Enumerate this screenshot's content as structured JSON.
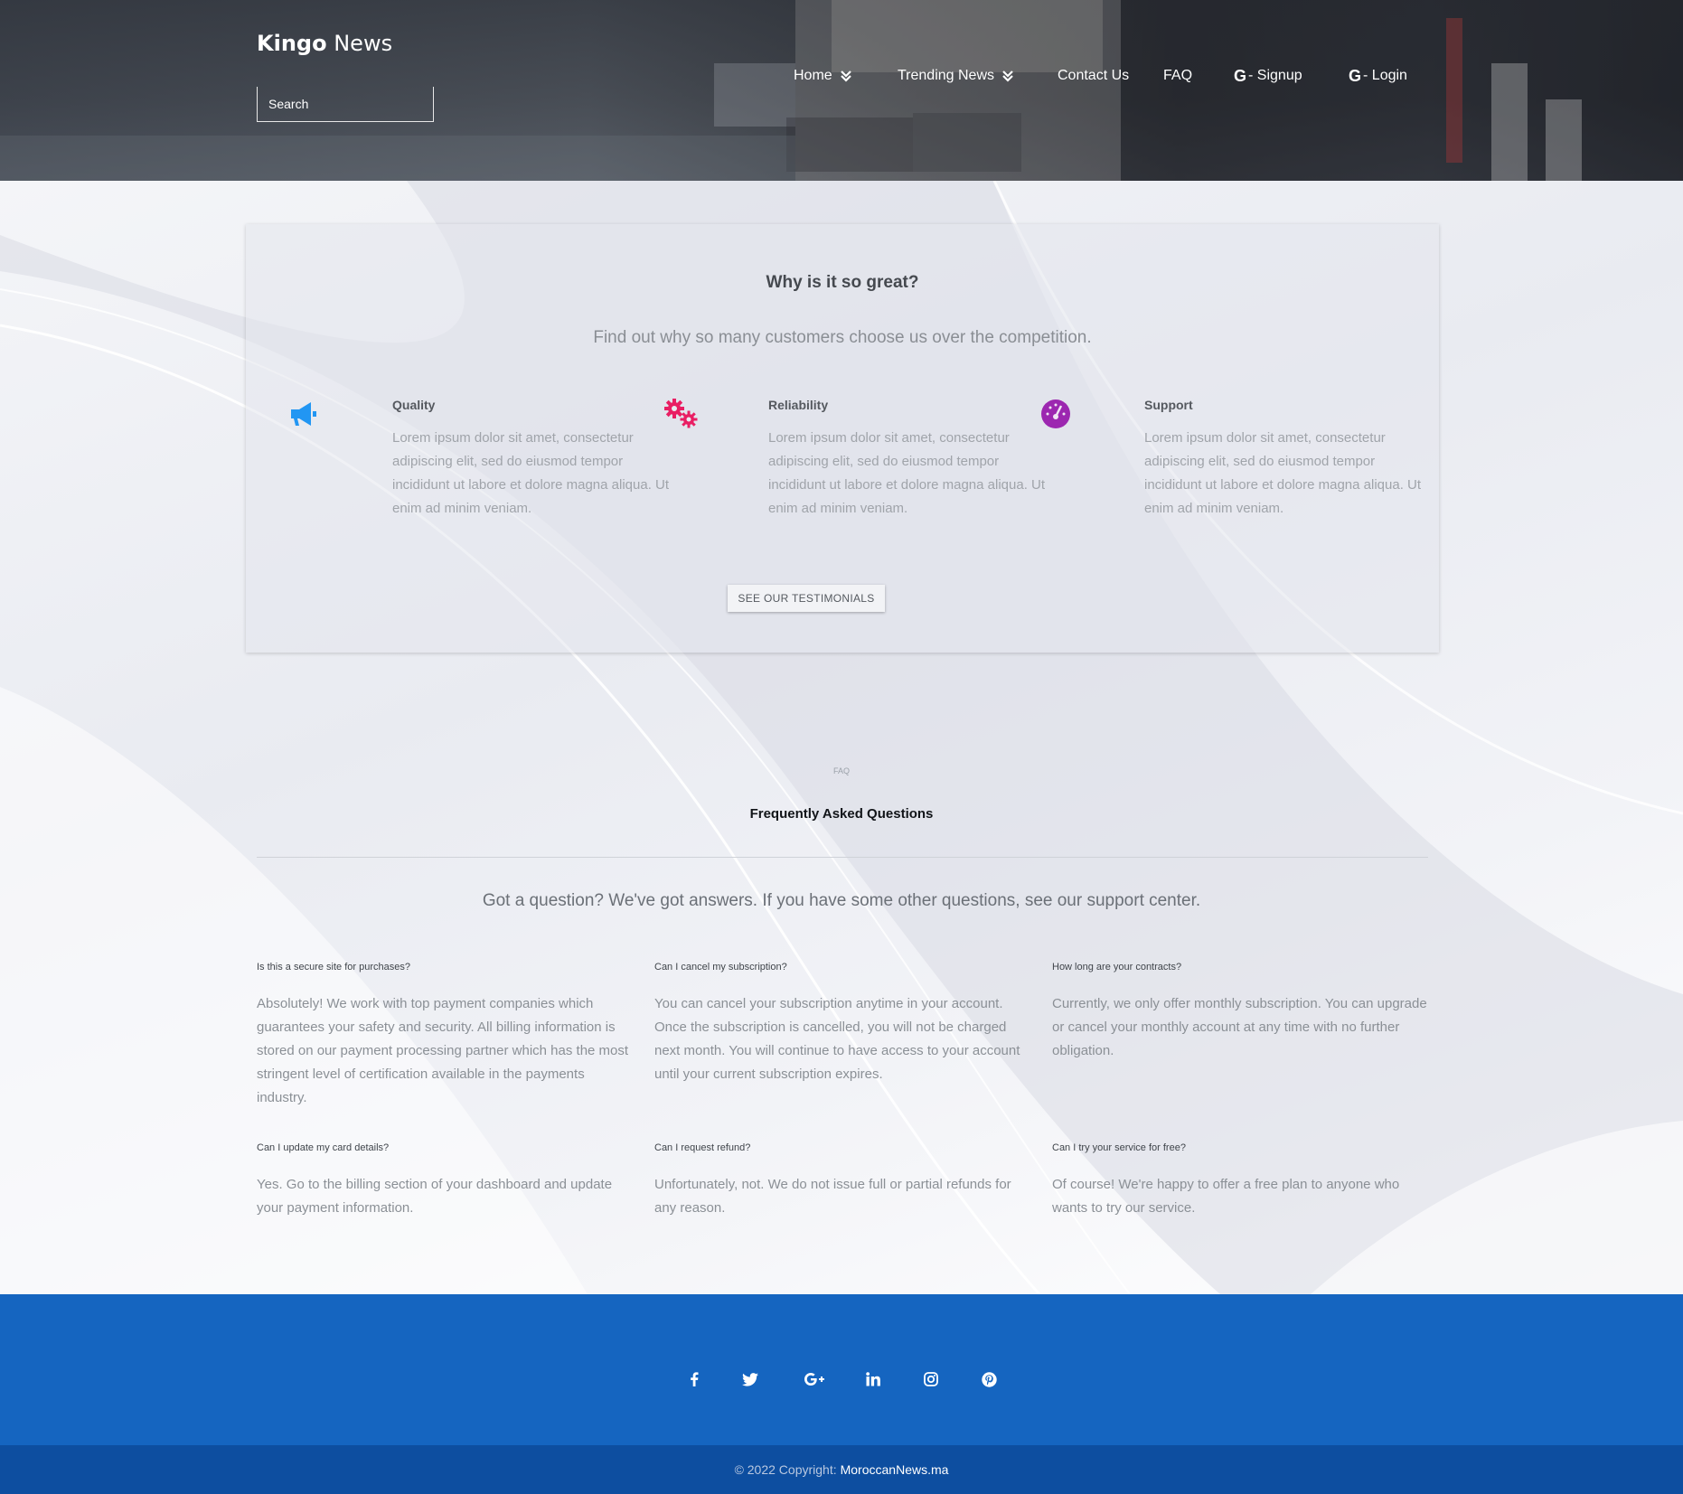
{
  "brand": {
    "bold": "Kingo",
    "regular": "News"
  },
  "search": {
    "placeholder": "Search"
  },
  "nav": {
    "home": "Home",
    "trending": "Trending News",
    "contact": "Contact Us",
    "faq": "FAQ",
    "signup": "- Signup",
    "login": "- Login",
    "google_glyph": "G"
  },
  "features": {
    "title": "Why is it so great?",
    "subtitle": "Find out why so many customers choose us over the competition.",
    "items": [
      {
        "icon": "megaphone-icon",
        "icon_color": "#2196f3",
        "title": "Quality",
        "text": "Lorem ipsum dolor sit amet, consectetur adipiscing elit, sed do eiusmod tempor incididunt ut labore et dolore magna aliqua. Ut enim ad minim veniam."
      },
      {
        "icon": "gears-icon",
        "icon_color": "#e91e63",
        "title": "Reliability",
        "text": "Lorem ipsum dolor sit amet, consectetur adipiscing elit, sed do eiusmod tempor incididunt ut labore et dolore magna aliqua. Ut enim ad minim veniam."
      },
      {
        "icon": "speedometer-icon",
        "icon_color": "#9c27b0",
        "title": "Support",
        "text": "Lorem ipsum dolor sit amet, consectetur adipiscing elit, sed do eiusmod tempor incididunt ut labore et dolore magna aliqua. Ut enim ad minim veniam."
      }
    ],
    "button": "SEE OUR TESTIMONIALS"
  },
  "faq": {
    "label": "FAQ",
    "title": "Frequently Asked Questions",
    "subtitle": "Got a question? We've got answers. If you have some other questions, see our support center.",
    "items": [
      {
        "q": "Is this a secure site for purchases?",
        "a": "Absolutely! We work with top payment companies which guarantees your safety and security. All billing information is stored on our payment processing partner which has the most stringent level of certification available in the payments industry."
      },
      {
        "q": "Can I cancel my subscription?",
        "a": "You can cancel your subscription anytime in your account. Once the subscription is cancelled, you will not be charged next month. You will continue to have access to your account until your current subscription expires."
      },
      {
        "q": "How long are your contracts?",
        "a": "Currently, we only offer monthly subscription. You can upgrade or cancel your monthly account at any time with no further obligation."
      },
      {
        "q": "Can I update my card details?",
        "a": "Yes. Go to the billing section of your dashboard and update your payment information."
      },
      {
        "q": "Can I request refund?",
        "a": "Unfortunately, not. We do not issue full or partial refunds for any reason."
      },
      {
        "q": "Can I try your service for free?",
        "a": "Of course! We're happy to offer a free plan to anyone who wants to try our service."
      }
    ]
  },
  "footer": {
    "social": [
      "facebook-icon",
      "twitter-icon",
      "google-plus-icon",
      "linkedin-icon",
      "instagram-icon",
      "pinterest-icon"
    ],
    "copyright": "© 2022 Copyright:",
    "link": "MoroccanNews.ma",
    "color": "#1565c0"
  }
}
